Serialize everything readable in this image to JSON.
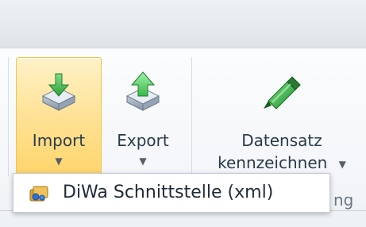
{
  "ribbon": {
    "buttons": {
      "import": {
        "label": "Import",
        "icon": "import-icon",
        "has_dropdown": true,
        "state": "active"
      },
      "export": {
        "label": "Export",
        "icon": "export-icon",
        "has_dropdown": true,
        "state": "normal"
      },
      "datensatz": {
        "label_line1": "Datensatz",
        "label_line2": "kennzeichnen",
        "icon": "marker-icon",
        "has_dropdown": true,
        "state": "normal"
      }
    },
    "group_label_partial": "ng"
  },
  "dropdown": {
    "open_for": "import",
    "items": [
      {
        "label": "DiWa Schnittstelle (xml)",
        "icon": "diwa-icon"
      }
    ]
  },
  "colors": {
    "active_button_fill": "#ffd56b",
    "active_button_border": "#f2c24d",
    "text": "#2b3a4a",
    "menu_border": "#c5cbd3",
    "import_arrow": "#3fb24a",
    "export_arrow": "#4fcf55",
    "marker": "#2faa3d"
  }
}
